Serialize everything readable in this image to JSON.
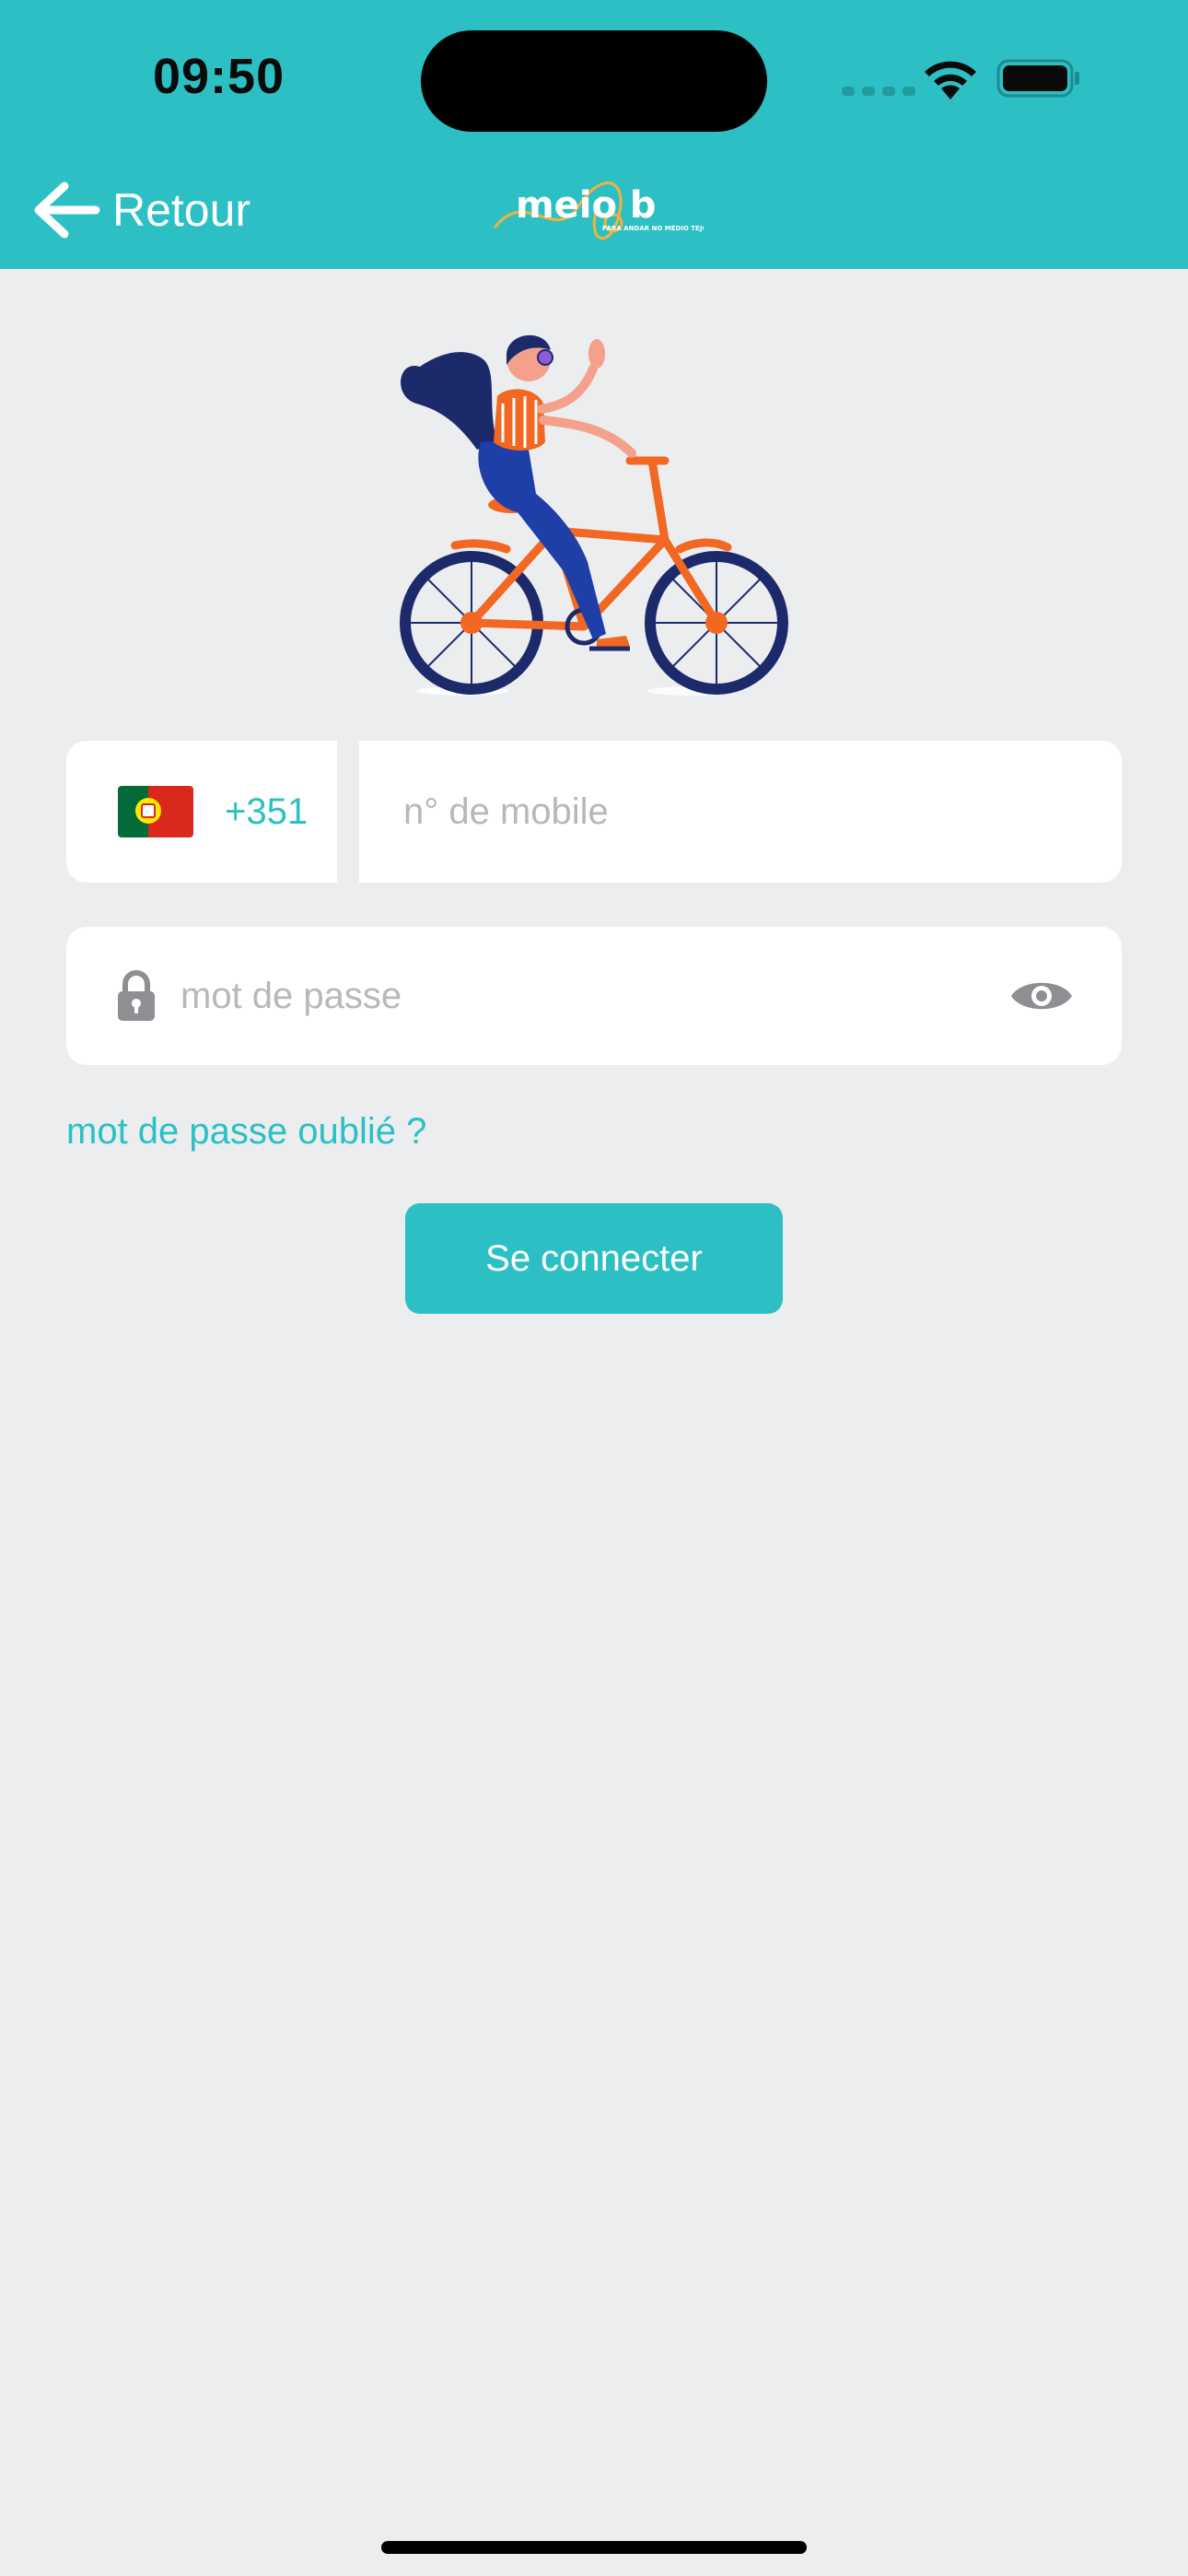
{
  "status_bar": {
    "time": "09:50"
  },
  "header": {
    "back_label": "Retour",
    "logo_text": "meio b",
    "logo_tagline": "PARA ANDAR NO MÉDIO TEJO"
  },
  "login_form": {
    "country_code": "+351",
    "country_flag": "Portugal",
    "phone_placeholder": "n° de mobile",
    "password_placeholder": "mot de passe",
    "forgot_password_label": "mot de passe oublié ?",
    "submit_label": "Se connecter"
  },
  "colors": {
    "accent": "#2CC0C4",
    "background": "#ECEDEF",
    "field": "#FFFFFF",
    "placeholder": "#B8B8B8"
  },
  "icons": {
    "back": "arrow-left-icon",
    "lock": "lock-icon",
    "visibility": "eye-icon",
    "wifi": "wifi-icon",
    "battery": "battery-icon"
  }
}
